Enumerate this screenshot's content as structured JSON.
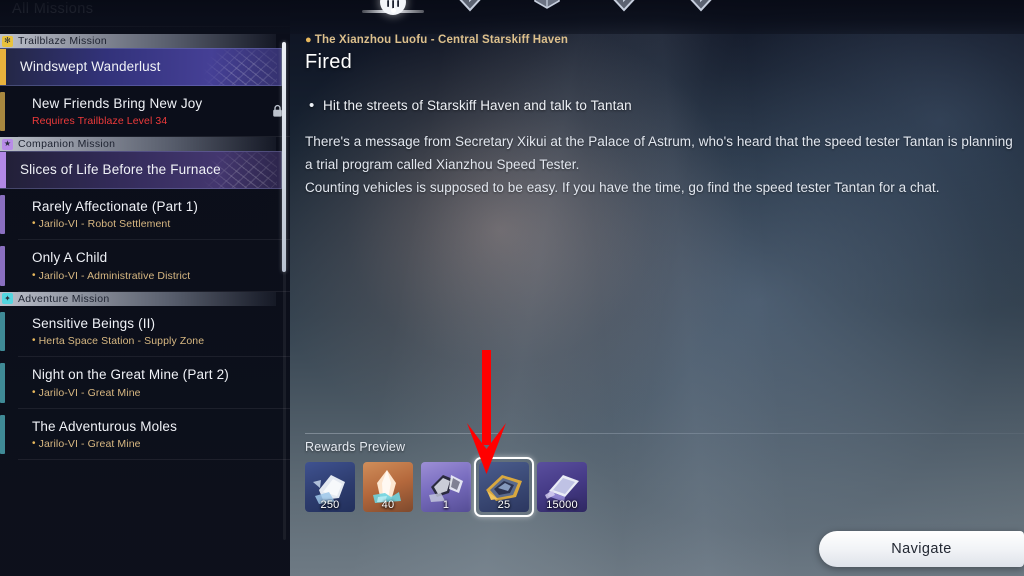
{
  "window": {
    "title": "All Missions"
  },
  "topbar": {
    "tabs": [
      {
        "name": "tab-missions",
        "icon": "compass-disc-icon",
        "active": true
      },
      {
        "name": "tab-two",
        "icon": "chevron-crest-icon",
        "active": false
      },
      {
        "name": "tab-three",
        "icon": "book-crest-icon",
        "active": false
      },
      {
        "name": "tab-four",
        "icon": "chevron-crest-icon",
        "active": false
      },
      {
        "name": "tab-five",
        "icon": "chevron-crest-icon",
        "active": false
      }
    ]
  },
  "mission_list": {
    "groups": [
      {
        "label": "Trailblaze Mission",
        "icon": "trailblaze-gear-icon",
        "accent": "#e8b23c",
        "header_bg": "#d6dae4",
        "items": [
          {
            "title": "Windswept Wanderlust",
            "sublabel": "",
            "location": "",
            "selected": true,
            "locked": false,
            "bar_color": "#e8b23c"
          },
          {
            "title": "New Friends Bring New Joy",
            "sublabel": "Requires Trailblaze Level 34",
            "location": "",
            "selected": false,
            "locked": true,
            "bar_color": "#a8873f"
          }
        ]
      },
      {
        "label": "Companion Mission",
        "icon": "companion-star-icon",
        "accent": "#b88ce8",
        "header_bg": "#cfd2e0",
        "items": [
          {
            "title": "Slices of Life Before the Furnace",
            "sublabel": "",
            "location": "",
            "selected": true,
            "locked": false,
            "bar_color": "#b288e6"
          },
          {
            "title": "Rarely Affectionate (Part 1)",
            "sublabel": "",
            "location": "Jarilo-VI - Robot Settlement",
            "selected": false,
            "locked": false,
            "bar_color": "#8a6fc0"
          },
          {
            "title": "Only A Child",
            "sublabel": "",
            "location": "Jarilo-VI - Administrative District",
            "selected": false,
            "locked": false,
            "bar_color": "#8a6fc0"
          }
        ]
      },
      {
        "label": "Adventure Mission",
        "icon": "adventure-diamond-icon",
        "accent": "#53d6e0",
        "header_bg": "#cdd1db",
        "items": [
          {
            "title": "Sensitive Beings (II)",
            "sublabel": "",
            "location": "Herta Space Station - Supply Zone",
            "selected": false,
            "locked": false,
            "bar_color": "#3f8a96"
          },
          {
            "title": "Night on the Great Mine (Part 2)",
            "sublabel": "",
            "location": "Jarilo-VI - Great Mine",
            "selected": false,
            "locked": false,
            "bar_color": "#3f8a96"
          },
          {
            "title": "The Adventurous Moles",
            "sublabel": "",
            "location": "Jarilo-VI - Great Mine",
            "selected": false,
            "locked": false,
            "bar_color": "#3f8a96"
          }
        ]
      }
    ]
  },
  "detail": {
    "location": "The Xianzhou Luofu - Central Starskiff Haven",
    "location_icon": "map-pin-icon",
    "title": "Fired",
    "objectives": [
      "Hit the streets of Starskiff Haven and talk to Tantan"
    ],
    "description": "There's a message from Secretary Xikui at the Palace of Astrum, who's heard that the speed tester Tantan is planning a trial program called Xianzhou Speed Tester.\nCounting vehicles is supposed to be easy. If you have the time, go find the speed tester Tantan for a chat."
  },
  "rewards": {
    "label": "Rewards Preview",
    "items": [
      {
        "name": "reward-trailblaze-exp",
        "qty": "250",
        "highlighted": false
      },
      {
        "name": "reward-credit-shard",
        "qty": "40",
        "highlighted": false
      },
      {
        "name": "reward-relic",
        "qty": "1",
        "highlighted": false
      },
      {
        "name": "reward-stellar-jade",
        "qty": "25",
        "highlighted": true
      },
      {
        "name": "reward-credits",
        "qty": "15000",
        "highlighted": false
      }
    ]
  },
  "footer": {
    "navigate_label": "Navigate"
  },
  "annotation": {
    "arrow_color": "#ff0000",
    "points_to": "reward-stellar-jade"
  }
}
